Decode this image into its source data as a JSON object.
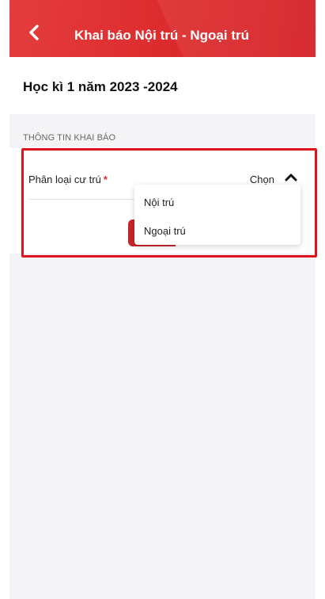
{
  "header": {
    "title": "Khai báo Nội trú - Ngoại trú",
    "back_icon": "chevron-left-icon",
    "color": "#dc2a2c"
  },
  "term": {
    "label": "Học kì 1 năm 2023 -2024"
  },
  "section": {
    "title": "THÔNG TIN KHAI BÁO"
  },
  "form": {
    "residence_label": "Phân loại cư trú",
    "required_marker": "*",
    "residence_value": "Chọn",
    "toggle_icon": "chevron-up-icon"
  },
  "dropdown": {
    "options": [
      "Nội trú",
      "Ngoại trú"
    ]
  },
  "colors": {
    "accent": "#dc2a2c",
    "highlight": "#e0141c",
    "background": "#f4f4f7"
  }
}
